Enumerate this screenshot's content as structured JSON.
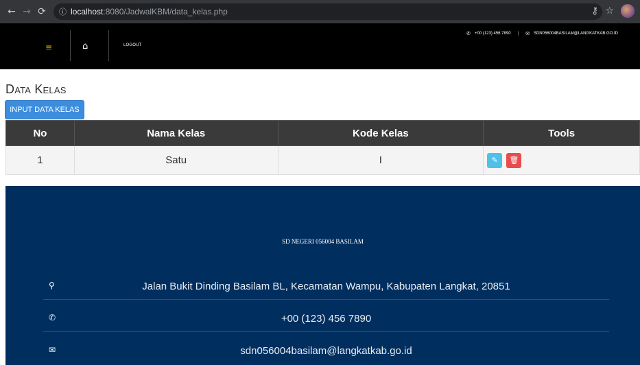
{
  "browser": {
    "url_host": "localhost",
    "url_path": ":8080/JadwalKBM/data_kelas.php"
  },
  "header": {
    "logout": "LOGOUT",
    "phone": "+00 (123) 456 7890",
    "email": "SDN056004BASILAM@LANGKATKAB.GO.ID"
  },
  "page": {
    "title": "Data Kelas",
    "input_button": "INPUT DATA KELAS"
  },
  "table": {
    "headers": [
      "No",
      "Nama Kelas",
      "Kode Kelas",
      "Tools"
    ],
    "rows": [
      {
        "no": "1",
        "nama": "Satu",
        "kode": "I"
      }
    ]
  },
  "footer": {
    "name": "SD NEGERI 056004 BASILAM",
    "address": "Jalan Bukit Dinding Basilam BL, Kecamatan Wampu, Kabupaten Langkat, 20851",
    "phone": "+00 (123) 456 7890",
    "email": "sdn056004basilam@langkatkab.go.id"
  },
  "colors": {
    "header_bg": "#000000",
    "button_primary": "#3c8dde",
    "table_header_bg": "#3a3a3a",
    "edit_button": "#4fc0e8",
    "delete_button": "#e84c4c",
    "footer_bg": "#002f5f"
  },
  "icons": {
    "menu": "hamburger-icon",
    "home": "home-icon",
    "phone": "phone-icon",
    "email": "envelope-icon",
    "edit": "pencil-icon",
    "delete": "trash-icon",
    "location": "map-marker-icon"
  }
}
